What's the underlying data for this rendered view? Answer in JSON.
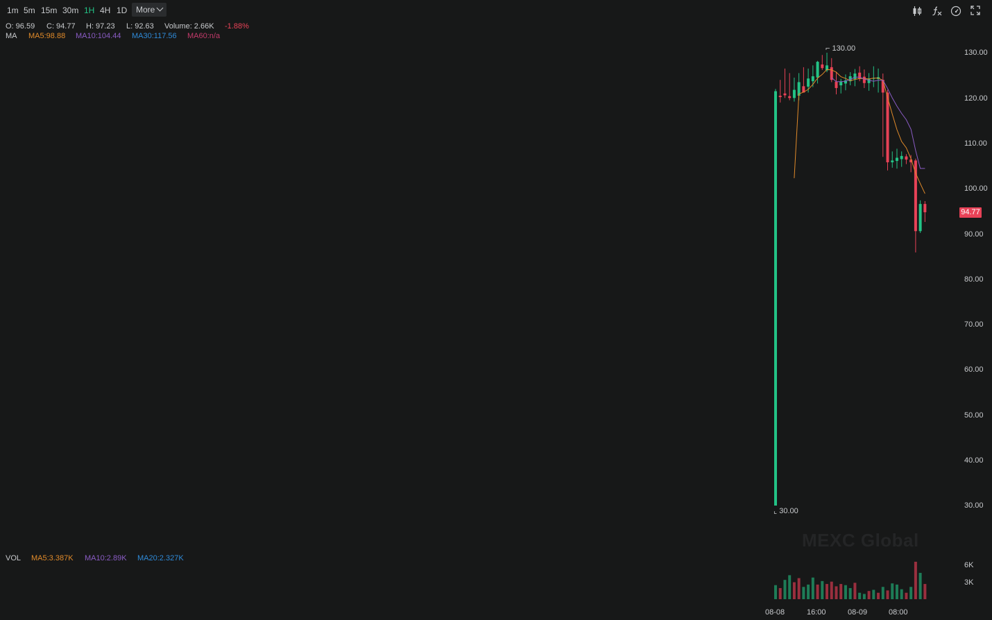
{
  "toolbar": {
    "timeframes": [
      "1m",
      "5m",
      "15m",
      "30m",
      "1H",
      "4H",
      "1D"
    ],
    "active": "1H",
    "more_label": "More",
    "tools": [
      "candle-type-icon",
      "indicator-fx-icon",
      "settings-dial-icon",
      "fullscreen-icon"
    ]
  },
  "ohlc": {
    "open": "O: 96.59",
    "close": "C: 94.77",
    "high": "H: 97.23",
    "low": "L: 92.63",
    "volume": "Volume: 2.66K",
    "change": "-1.88%"
  },
  "ma_row": {
    "label": "MA",
    "ma5": "MA5:98.88",
    "ma10": "MA10:104.44",
    "ma30": "MA30:117.56",
    "ma60": "MA60:n/a"
  },
  "vol_row": {
    "label": "VOL",
    "ma5": "MA5:3.387K",
    "ma10": "MA10:2.89K",
    "ma20": "MA20:2.327K"
  },
  "colors": {
    "up": "#23c386",
    "down": "#e84257",
    "ma5": "#e08a2a",
    "ma10": "#8a5cc4",
    "ma30": "#2f8ad8",
    "ma60": "#c23a6a"
  },
  "chart_data": {
    "type": "candlestick",
    "y_ticks": [
      "130.00",
      "120.00",
      "110.00",
      "100.00",
      "90.00",
      "80.00",
      "70.00",
      "60.00",
      "50.00",
      "40.00",
      "30.00"
    ],
    "ylim": [
      30,
      130
    ],
    "x_ticks": [
      "08-08",
      "16:00",
      "08-09",
      "08:00"
    ],
    "last_price": "94.77",
    "high_marker": "130.00",
    "low_marker": "30.00",
    "watermark": "MEXC Global",
    "vol_ticks": [
      "6K",
      "3K"
    ],
    "candles": [
      {
        "o": 30,
        "h": 122,
        "l": 30,
        "c": 121.5
      },
      {
        "o": 120.5,
        "h": 124,
        "l": 119,
        "c": 120.2
      },
      {
        "o": 121,
        "h": 126.5,
        "l": 120,
        "c": 120.6
      },
      {
        "o": 120.4,
        "h": 125.5,
        "l": 119.5,
        "c": 120.0
      },
      {
        "o": 120,
        "h": 124.5,
        "l": 119.2,
        "c": 121.8
      },
      {
        "o": 120.5,
        "h": 125.5,
        "l": 119.5,
        "c": 123.5
      },
      {
        "o": 122.6,
        "h": 126.8,
        "l": 121.2,
        "c": 121.2
      },
      {
        "o": 122.5,
        "h": 126.5,
        "l": 121.2,
        "c": 124.3
      },
      {
        "o": 123.7,
        "h": 127.2,
        "l": 122.4,
        "c": 124.8
      },
      {
        "o": 124.5,
        "h": 128.2,
        "l": 123.2,
        "c": 128
      },
      {
        "o": 127.4,
        "h": 129.5,
        "l": 126.2,
        "c": 126.6
      },
      {
        "o": 126.1,
        "h": 130,
        "l": 125.7,
        "c": 127.2
      },
      {
        "o": 126.8,
        "h": 128.8,
        "l": 123.5,
        "c": 124
      },
      {
        "o": 123.6,
        "h": 125.8,
        "l": 120.8,
        "c": 122.2
      },
      {
        "o": 122.8,
        "h": 124.2,
        "l": 121.0,
        "c": 123.6
      },
      {
        "o": 123.2,
        "h": 125.2,
        "l": 121.7,
        "c": 123.9
      },
      {
        "o": 123.7,
        "h": 125.7,
        "l": 122.8,
        "c": 124.8
      },
      {
        "o": 124.2,
        "h": 126.4,
        "l": 122.6,
        "c": 125.4
      },
      {
        "o": 125.6,
        "h": 127,
        "l": 123.7,
        "c": 124.2
      },
      {
        "o": 124.7,
        "h": 126.3,
        "l": 122.2,
        "c": 123.3
      },
      {
        "o": 123.3,
        "h": 125.5,
        "l": 121.6,
        "c": 124.3
      },
      {
        "o": 124.4,
        "h": 127,
        "l": 122.4,
        "c": 124.4
      },
      {
        "o": 124.2,
        "h": 126.5,
        "l": 121.2,
        "c": 124.6
      },
      {
        "o": 124,
        "h": 125.4,
        "l": 107,
        "c": 121.2
      },
      {
        "o": 121.2,
        "h": 121.8,
        "l": 104,
        "c": 105.8
      },
      {
        "o": 105.8,
        "h": 108.2,
        "l": 104.6,
        "c": 106.2
      },
      {
        "o": 106.1,
        "h": 108.8,
        "l": 104.4,
        "c": 106.8
      },
      {
        "o": 106.5,
        "h": 108.2,
        "l": 104.8,
        "c": 107.2
      },
      {
        "o": 107.1,
        "h": 107.6,
        "l": 105.4,
        "c": 106.4
      },
      {
        "o": 106.4,
        "h": 107.4,
        "l": 103.6,
        "c": 105.8
      },
      {
        "o": 106.2,
        "h": 106.6,
        "l": 85.9,
        "c": 90.6
      },
      {
        "o": 90.6,
        "h": 97.4,
        "l": 90.2,
        "c": 96.6
      },
      {
        "o": 96.6,
        "h": 97.23,
        "l": 92.63,
        "c": 94.77
      }
    ],
    "ma5": [
      null,
      null,
      null,
      null,
      102.3,
      120.9,
      121.3,
      121.9,
      123,
      124.4,
      125.2,
      126.3,
      126.2,
      125.7,
      124.7,
      124.3,
      123.8,
      124.1,
      124.3,
      124.3,
      124.2,
      124.4,
      124.4,
      123.9,
      120.1,
      116.4,
      113,
      110.4,
      109.0,
      106.6,
      103.4,
      101.1,
      98.88
    ],
    "ma10": [
      null,
      null,
      null,
      null,
      null,
      null,
      null,
      null,
      null,
      null,
      null,
      null,
      124.5,
      123.6,
      123.6,
      123.7,
      124.1,
      124.6,
      124.6,
      124.2,
      123.9,
      123.7,
      123.9,
      123.9,
      122.1,
      120,
      118.2,
      116.6,
      115.2,
      113.1,
      108.4,
      104.44,
      104.44
    ]
  },
  "volume": [
    {
      "v": 2.4,
      "up": true
    },
    {
      "v": 1.9,
      "up": false
    },
    {
      "v": 3.3,
      "up": true
    },
    {
      "v": 4.1,
      "up": true
    },
    {
      "v": 2.9,
      "up": false
    },
    {
      "v": 3.6,
      "up": false
    },
    {
      "v": 2.1,
      "up": true
    },
    {
      "v": 2.5,
      "up": true
    },
    {
      "v": 3.7,
      "up": true
    },
    {
      "v": 2.5,
      "up": false
    },
    {
      "v": 3.1,
      "up": true
    },
    {
      "v": 2.6,
      "up": false
    },
    {
      "v": 3.0,
      "up": false
    },
    {
      "v": 2.2,
      "up": false
    },
    {
      "v": 2.6,
      "up": false
    },
    {
      "v": 2.4,
      "up": true
    },
    {
      "v": 1.9,
      "up": true
    },
    {
      "v": 2.8,
      "up": false
    },
    {
      "v": 1.1,
      "up": true
    },
    {
      "v": 0.9,
      "up": true
    },
    {
      "v": 1.4,
      "up": false
    },
    {
      "v": 1.6,
      "up": true
    },
    {
      "v": 1.1,
      "up": false
    },
    {
      "v": 2.1,
      "up": true
    },
    {
      "v": 1.5,
      "up": false
    },
    {
      "v": 2.7,
      "up": true
    },
    {
      "v": 2.5,
      "up": true
    },
    {
      "v": 1.7,
      "up": true
    },
    {
      "v": 1.1,
      "up": false
    },
    {
      "v": 2.1,
      "up": true
    },
    {
      "v": 6.4,
      "up": false
    },
    {
      "v": 4.5,
      "up": true
    },
    {
      "v": 2.6,
      "up": false
    }
  ]
}
